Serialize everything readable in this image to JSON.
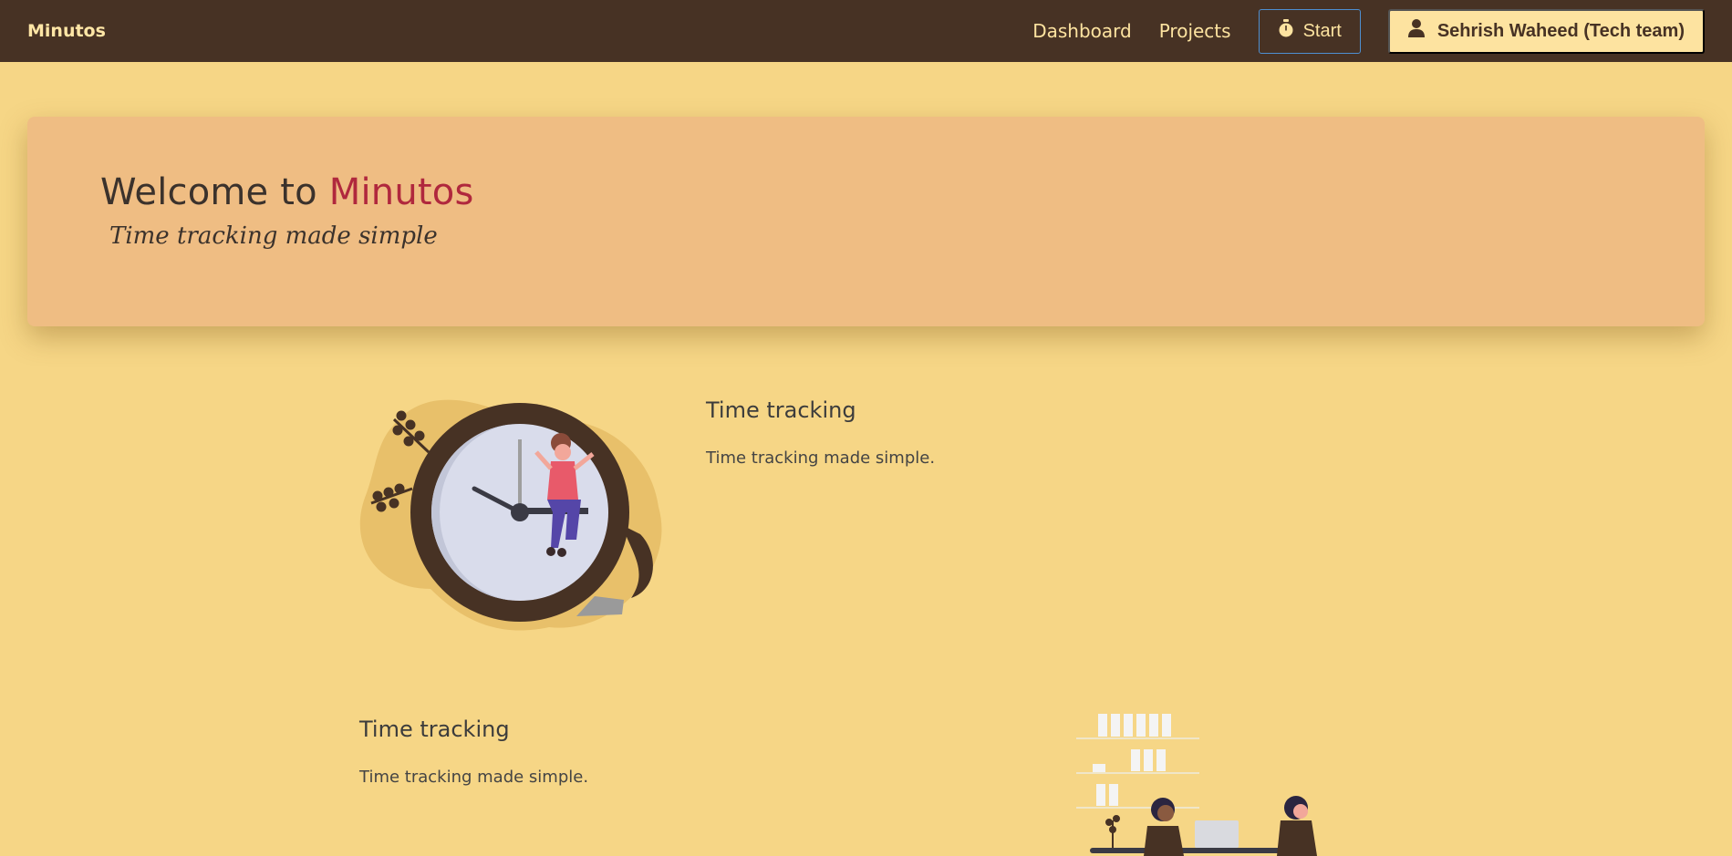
{
  "navbar": {
    "brand": "Minutos",
    "links": [
      "Dashboard",
      "Projects"
    ],
    "start_label": "Start",
    "user_label": "Sehrish Waheed (Tech team)"
  },
  "hero": {
    "title_prefix": "Welcome to ",
    "title_accent": "Minutos",
    "subtitle": "Time tracking made simple"
  },
  "features": [
    {
      "title": "Time tracking",
      "description": "Time tracking made simple."
    },
    {
      "title": "Time tracking",
      "description": "Time tracking made simple."
    }
  ],
  "colors": {
    "navbar_bg": "#473224",
    "page_bg": "#f6d686",
    "hero_bg": "#efbd83",
    "accent": "#b0283d",
    "user_button_bg": "#fde3a0"
  },
  "icons": {
    "start": "stopwatch-icon",
    "user": "user-icon"
  }
}
